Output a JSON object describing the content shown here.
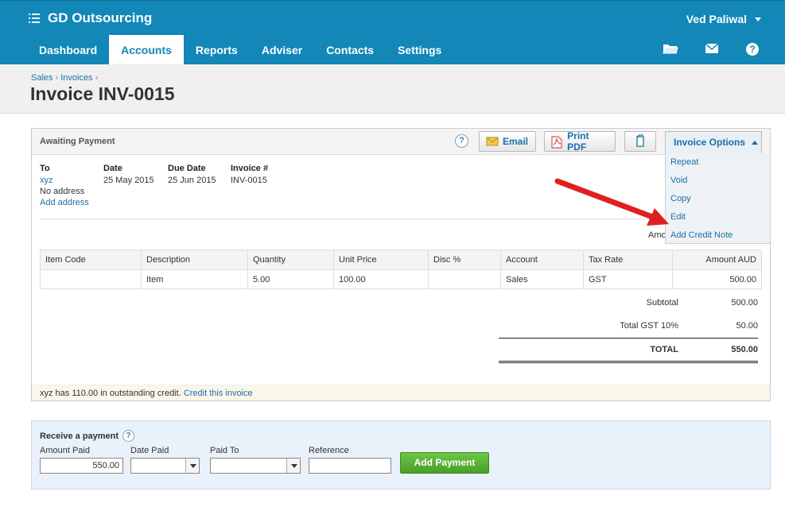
{
  "app": {
    "name": "GD Outsourcing",
    "user": "Ved Paliwal"
  },
  "nav": {
    "tabs": [
      "Dashboard",
      "Accounts",
      "Reports",
      "Adviser",
      "Contacts",
      "Settings"
    ],
    "active": "Accounts"
  },
  "breadcrumb": {
    "items": [
      "Sales",
      "Invoices"
    ]
  },
  "page": {
    "title": "Invoice INV-0015"
  },
  "invoice": {
    "status": "Awaiting Payment",
    "buttons": {
      "help": "?",
      "email": "Email",
      "print_pdf": "Print PDF",
      "options": "Invoice Options"
    },
    "options_menu": [
      "Repeat",
      "Void",
      "Copy",
      "Edit",
      "Add Credit Note"
    ],
    "to": {
      "label": "To",
      "name": "xyz",
      "address": "No address",
      "add_address": "Add address"
    },
    "date": {
      "label": "Date",
      "value": "25 May 2015"
    },
    "due_date": {
      "label": "Due Date",
      "value": "25 Jun 2015"
    },
    "number": {
      "label": "Invoice #",
      "value": "INV-0015"
    },
    "amounts_label": "Amo",
    "columns": [
      "Item Code",
      "Description",
      "Quantity",
      "Unit Price",
      "Disc %",
      "Account",
      "Tax Rate",
      "Amount AUD"
    ],
    "rows": [
      {
        "item_code": "",
        "description": "Item",
        "quantity": "5.00",
        "unit_price": "100.00",
        "disc": "",
        "account": "Sales",
        "tax_rate": "GST",
        "amount": "500.00"
      }
    ],
    "totals": {
      "subtotal_label": "Subtotal",
      "subtotal": "500.00",
      "gst_label": "Total GST 10%",
      "gst": "50.00",
      "total_label": "TOTAL",
      "total": "550.00"
    },
    "credit_notice": "xyz has 110.00 in outstanding credit.",
    "credit_link": "Credit this invoice"
  },
  "payment": {
    "title": "Receive a payment",
    "amount_label": "Amount Paid",
    "amount_value": "550.00",
    "date_label": "Date Paid",
    "date_value": "",
    "paid_to_label": "Paid To",
    "paid_to_value": "",
    "reference_label": "Reference",
    "reference_value": "",
    "submit": "Add Payment"
  },
  "colors": {
    "brand": "#1287b8",
    "link": "#1a6fa8",
    "success": "#5cb338",
    "annotation": "#e02020"
  },
  "icons": [
    "menu-icon",
    "caret-down-icon",
    "folder-icon",
    "mail-icon",
    "help-icon",
    "email-icon",
    "pdf-icon",
    "copy-icon",
    "arrow-annotation"
  ]
}
